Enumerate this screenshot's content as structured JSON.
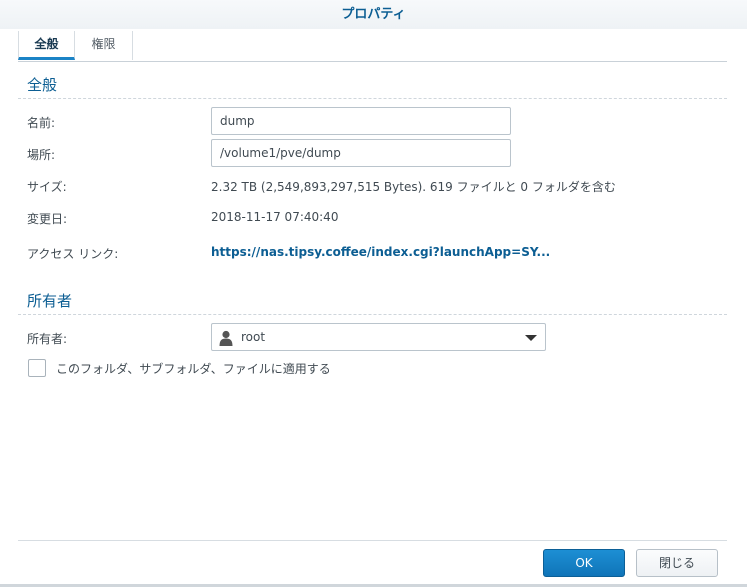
{
  "dialog": {
    "title": "プロパティ"
  },
  "tabs": [
    {
      "label": "全般",
      "active": true
    },
    {
      "label": "権限",
      "active": false
    }
  ],
  "general": {
    "section_title": "全般",
    "name_label": "名前:",
    "name_value": "dump",
    "location_label": "場所:",
    "location_value": "/volume1/pve/dump",
    "size_label": "サイズ:",
    "size_value": "2.32 TB (2,549,893,297,515 Bytes). 619 ファイルと 0 フォルダを含む",
    "modified_label": "変更日:",
    "modified_value": "2018-11-17 07:40:40",
    "access_link_label": "アクセス リンク:",
    "access_link_value": "https://nas.tipsy.coffee/index.cgi?launchApp=SY..."
  },
  "owner": {
    "section_title": "所有者",
    "owner_label": "所有者:",
    "owner_value": "root",
    "apply_checkbox_label": "このフォルダ、サブフォルダ、ファイルに適用する",
    "apply_checked": false
  },
  "buttons": {
    "ok": "OK",
    "close": "閉じる"
  },
  "colors": {
    "accent": "#0c5e93",
    "primary_button": "#1683c8",
    "tab_underline": "#1b83c6"
  },
  "icons": {
    "owner_select": "user-icon",
    "dropdown": "caret-down-icon"
  }
}
